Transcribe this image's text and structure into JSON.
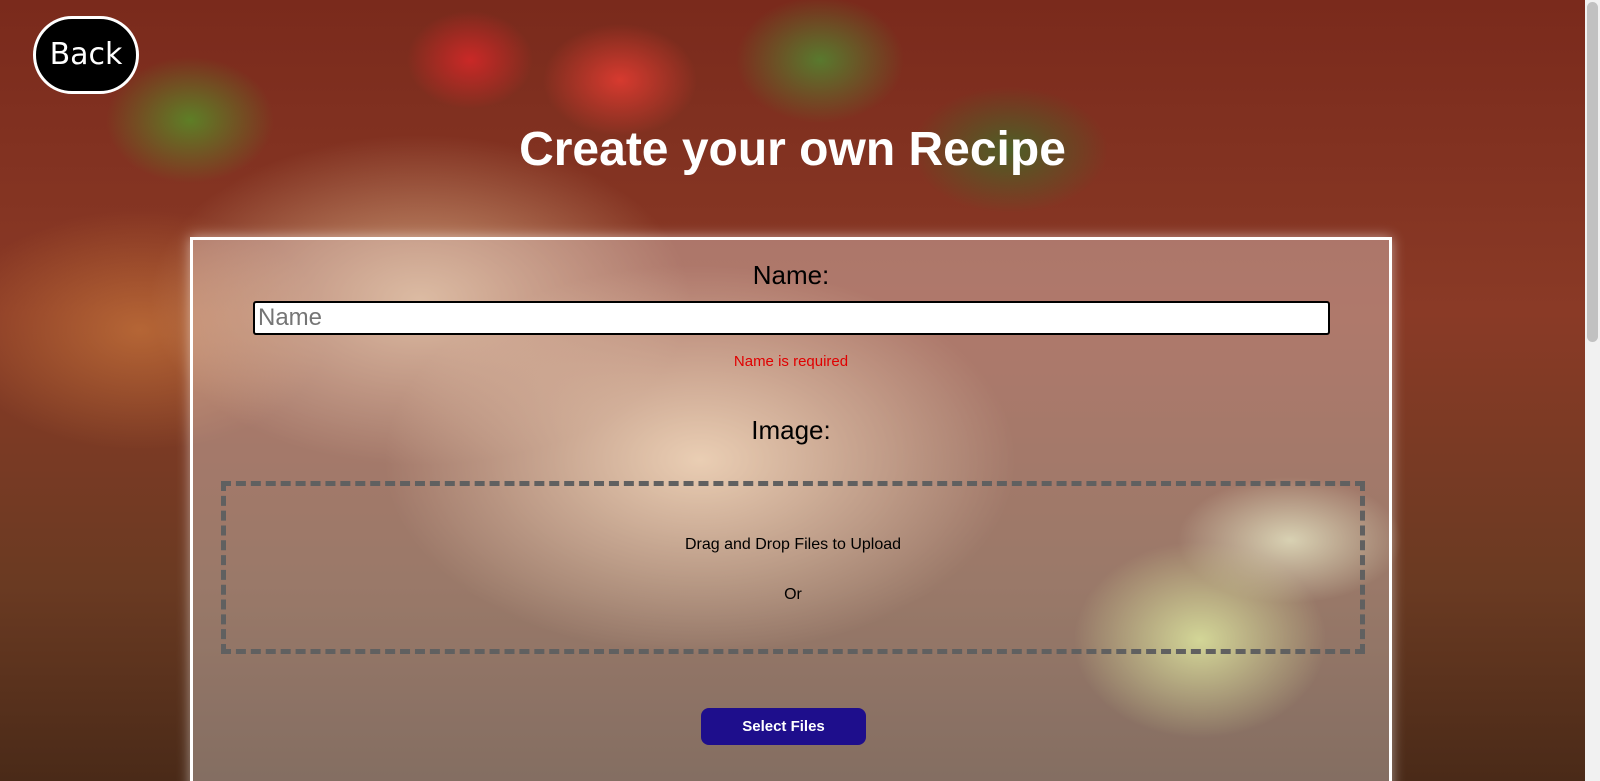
{
  "header": {
    "back_label": "Back",
    "title": "Create your own Recipe"
  },
  "form": {
    "name_label": "Name:",
    "name_placeholder": "Name",
    "name_value": "",
    "name_error": "Name is required",
    "image_label": "Image:",
    "drop_zone": {
      "instruction": "Drag and Drop Files to Upload",
      "or_text": "Or"
    },
    "select_files_label": "Select Files"
  },
  "colors": {
    "back_button_bg": "#000000",
    "error_text": "#e00000",
    "select_files_bg": "#1e0e8c",
    "title_text": "#ffffff"
  }
}
